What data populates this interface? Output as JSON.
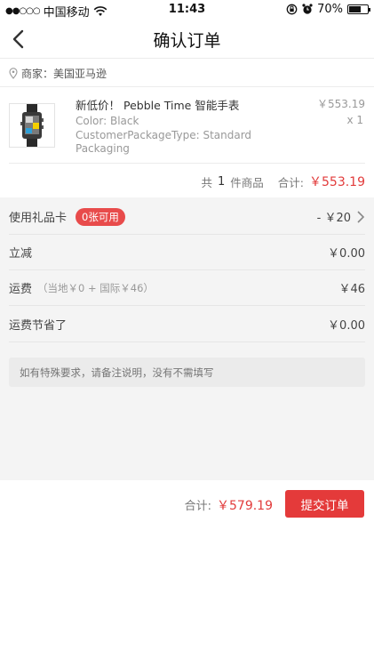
{
  "status_bar": {
    "signal": "●●○○○",
    "carrier": "中国移动",
    "time": "11:43",
    "battery_percent": "70%",
    "battery_level": 0.7
  },
  "nav": {
    "title": "确认订单"
  },
  "merchant": {
    "label": "商家：美国亚马逊"
  },
  "product": {
    "name": "新低价！ Pebble Time 智能手表",
    "price": "￥553.19",
    "quantity": "x 1",
    "spec_lines": [
      "Color: Black",
      "CustomerPackageType: Standard",
      "Packaging"
    ]
  },
  "summary": {
    "count_prefix": "共",
    "count": "1",
    "count_suffix": "件商品",
    "total_label": "合计:",
    "total_value": "￥553.19"
  },
  "options": {
    "gift_card": {
      "label": "使用礼品卡",
      "badge": "0张可用",
      "value": "- ￥20"
    },
    "discount": {
      "label": "立减",
      "value": "￥0.00"
    },
    "shipping": {
      "label": "运费",
      "hint": "（当地￥0 + 国际￥46）",
      "value": "￥46"
    },
    "shipping_saved": {
      "label": "运费节省了",
      "value": "￥0.00"
    }
  },
  "remark": {
    "placeholder": "如有特殊要求，请备注说明，没有不需填写"
  },
  "footer": {
    "total_label": "合计:",
    "total_value": "￥579.19",
    "submit_label": "提交订单"
  },
  "colors": {
    "accent": "#e43a3a",
    "background_gray": "#f4f4f4"
  }
}
